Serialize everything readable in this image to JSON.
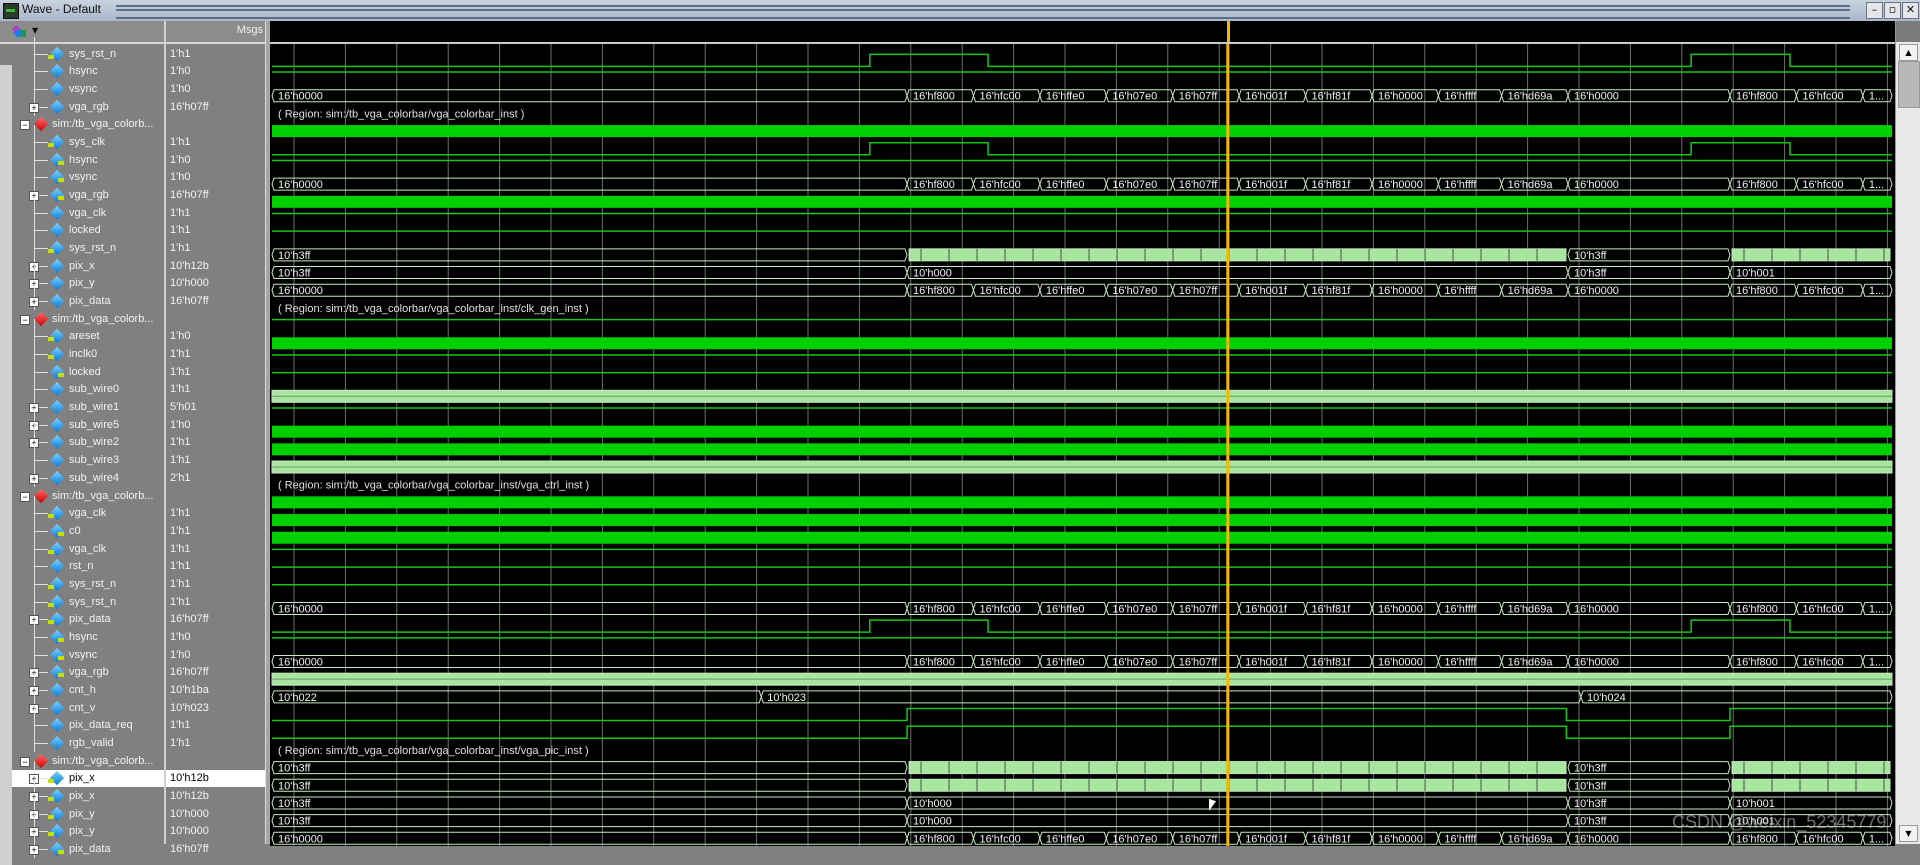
{
  "window": {
    "title": "Wave - Default",
    "buttons": [
      "minimize",
      "restore",
      "close"
    ]
  },
  "header": {
    "msgs_label": "Msgs",
    "toolbar_icon": "wave-format-icon"
  },
  "cursor": {
    "time_fraction": 0.59,
    "color": "#f5b800"
  },
  "colors": {
    "bus": "#c9e7c4",
    "scalar": "#14c814",
    "clockfill": "#00d000",
    "grid": "#8a8a8a",
    "busfill": "#a8e6a0",
    "region": "#e0e0e0"
  },
  "watermark": "CSDN @weixin_52345779",
  "rows": [
    {
      "type": "sig",
      "name": "sys_rst_n",
      "value": "1'h1",
      "indent": 1,
      "expand": false,
      "io": "in",
      "wave": {
        "kind": "scalar",
        "level": 1
      }
    },
    {
      "type": "sig",
      "name": "hsync",
      "value": "1'h0",
      "indent": 1,
      "expand": false,
      "io": "none",
      "wave": {
        "kind": "pulse",
        "pulses": [
          [
            0.369,
            0.442
          ],
          [
            0.876,
            0.937
          ]
        ]
      }
    },
    {
      "type": "sig",
      "name": "vsync",
      "value": "1'h0",
      "indent": 1,
      "expand": false,
      "io": "none",
      "wave": {
        "kind": "scalar",
        "level": 1
      }
    },
    {
      "type": "sig",
      "name": "vga_rgb",
      "value": "16'h07ff",
      "indent": 1,
      "expand": true,
      "io": "none",
      "wave": {
        "kind": "bus",
        "set": "rgb"
      }
    },
    {
      "type": "grp",
      "name": "sim:/tb_vga_colorb...",
      "region": "( Region: sim:/tb_vga_colorbar/vga_colorbar_inst )"
    },
    {
      "type": "sig",
      "name": "sys_clk",
      "value": "1'h1",
      "indent": 1,
      "expand": false,
      "io": "in",
      "wave": {
        "kind": "clock"
      }
    },
    {
      "type": "sig",
      "name": "hsync",
      "value": "1'h0",
      "indent": 1,
      "expand": false,
      "io": "out",
      "wave": {
        "kind": "pulse",
        "pulses": [
          [
            0.369,
            0.442
          ],
          [
            0.876,
            0.937
          ]
        ]
      }
    },
    {
      "type": "sig",
      "name": "vsync",
      "value": "1'h0",
      "indent": 1,
      "expand": false,
      "io": "out",
      "wave": {
        "kind": "scalar",
        "level": 1
      }
    },
    {
      "type": "sig",
      "name": "vga_rgb",
      "value": "16'h07ff",
      "indent": 1,
      "expand": true,
      "io": "out",
      "wave": {
        "kind": "bus",
        "set": "rgb"
      }
    },
    {
      "type": "sig",
      "name": "vga_clk",
      "value": "1'h1",
      "indent": 1,
      "expand": false,
      "io": "none",
      "wave": {
        "kind": "clock"
      }
    },
    {
      "type": "sig",
      "name": "locked",
      "value": "1'h1",
      "indent": 1,
      "expand": false,
      "io": "none",
      "wave": {
        "kind": "scalar",
        "level": 1
      }
    },
    {
      "type": "sig",
      "name": "sys_rst_n",
      "value": "1'h1",
      "indent": 1,
      "expand": false,
      "io": "in",
      "wave": {
        "kind": "scalar",
        "level": 1
      }
    },
    {
      "type": "sig",
      "name": "pix_x",
      "value": "10'h12b",
      "indent": 1,
      "expand": true,
      "io": "none",
      "wave": {
        "kind": "bus",
        "set": "pixx"
      }
    },
    {
      "type": "sig",
      "name": "pix_y",
      "value": "10'h000",
      "indent": 1,
      "expand": true,
      "io": "none",
      "wave": {
        "kind": "bus",
        "set": "pixy"
      }
    },
    {
      "type": "sig",
      "name": "pix_data",
      "value": "16'h07ff",
      "indent": 1,
      "expand": true,
      "io": "none",
      "wave": {
        "kind": "bus",
        "set": "rgb"
      }
    },
    {
      "type": "grp",
      "name": "sim:/tb_vga_colorb...",
      "region": "( Region: sim:/tb_vga_colorbar/vga_colorbar_inst/clk_gen_inst )"
    },
    {
      "type": "sig",
      "name": "areset",
      "value": "1'h0",
      "indent": 1,
      "expand": false,
      "io": "in",
      "wave": {
        "kind": "scalar",
        "level": 1
      }
    },
    {
      "type": "sig",
      "name": "inclk0",
      "value": "1'h1",
      "indent": 1,
      "expand": false,
      "io": "in",
      "wave": {
        "kind": "clock"
      }
    },
    {
      "type": "sig",
      "name": "locked",
      "value": "1'h1",
      "indent": 1,
      "expand": false,
      "io": "out",
      "wave": {
        "kind": "scalar",
        "level": 1
      }
    },
    {
      "type": "sig",
      "name": "sub_wire0",
      "value": "1'h1",
      "indent": 1,
      "expand": false,
      "io": "none",
      "wave": {
        "kind": "scalar",
        "level": 1
      }
    },
    {
      "type": "sig",
      "name": "sub_wire1",
      "value": "5'h01",
      "indent": 1,
      "expand": true,
      "io": "none",
      "wave": {
        "kind": "busfast"
      }
    },
    {
      "type": "sig",
      "name": "sub_wire5",
      "value": "1'h0",
      "indent": 1,
      "expand": true,
      "io": "none",
      "wave": {
        "kind": "scalar",
        "level": 1
      }
    },
    {
      "type": "sig",
      "name": "sub_wire2",
      "value": "1'h1",
      "indent": 1,
      "expand": true,
      "io": "none",
      "wave": {
        "kind": "clock"
      }
    },
    {
      "type": "sig",
      "name": "sub_wire3",
      "value": "1'h1",
      "indent": 1,
      "expand": false,
      "io": "none",
      "wave": {
        "kind": "clock"
      }
    },
    {
      "type": "sig",
      "name": "sub_wire4",
      "value": "2'h1",
      "indent": 1,
      "expand": true,
      "io": "none",
      "wave": {
        "kind": "busfast"
      }
    },
    {
      "type": "grp",
      "name": "sim:/tb_vga_colorb...",
      "region": "( Region: sim:/tb_vga_colorbar/vga_colorbar_inst/vga_ctrl_inst )"
    },
    {
      "type": "sig",
      "name": "vga_clk",
      "value": "1'h1",
      "indent": 1,
      "expand": false,
      "io": "in",
      "wave": {
        "kind": "clock"
      }
    },
    {
      "type": "sig",
      "name": "c0",
      "value": "1'h1",
      "indent": 1,
      "expand": false,
      "io": "out",
      "wave": {
        "kind": "clock"
      }
    },
    {
      "type": "sig",
      "name": "vga_clk",
      "value": "1'h1",
      "indent": 1,
      "expand": false,
      "io": "in",
      "wave": {
        "kind": "clock"
      }
    },
    {
      "type": "sig",
      "name": "rst_n",
      "value": "1'h1",
      "indent": 1,
      "expand": false,
      "io": "none",
      "wave": {
        "kind": "scalar",
        "level": 1
      }
    },
    {
      "type": "sig",
      "name": "sys_rst_n",
      "value": "1'h1",
      "indent": 1,
      "expand": false,
      "io": "in",
      "wave": {
        "kind": "scalar",
        "level": 1
      }
    },
    {
      "type": "sig",
      "name": "sys_rst_n",
      "value": "1'h1",
      "indent": 1,
      "expand": false,
      "io": "in",
      "wave": {
        "kind": "scalar",
        "level": 1
      }
    },
    {
      "type": "sig",
      "name": "pix_data",
      "value": "16'h07ff",
      "indent": 1,
      "expand": true,
      "io": "in",
      "wave": {
        "kind": "bus",
        "set": "rgb"
      }
    },
    {
      "type": "sig",
      "name": "hsync",
      "value": "1'h0",
      "indent": 1,
      "expand": false,
      "io": "out",
      "wave": {
        "kind": "pulse",
        "pulses": [
          [
            0.369,
            0.442
          ],
          [
            0.876,
            0.937
          ]
        ]
      }
    },
    {
      "type": "sig",
      "name": "vsync",
      "value": "1'h0",
      "indent": 1,
      "expand": false,
      "io": "out",
      "wave": {
        "kind": "scalar",
        "level": 1
      }
    },
    {
      "type": "sig",
      "name": "vga_rgb",
      "value": "16'h07ff",
      "indent": 1,
      "expand": true,
      "io": "out",
      "wave": {
        "kind": "bus",
        "set": "rgb"
      }
    },
    {
      "type": "sig",
      "name": "cnt_h",
      "value": "10'h1ba",
      "indent": 1,
      "expand": true,
      "io": "none",
      "wave": {
        "kind": "busfast"
      }
    },
    {
      "type": "sig",
      "name": "cnt_v",
      "value": "10'h023",
      "indent": 1,
      "expand": true,
      "io": "none",
      "wave": {
        "kind": "bus",
        "set": "cntv"
      }
    },
    {
      "type": "sig",
      "name": "pix_data_req",
      "value": "1'h1",
      "indent": 1,
      "expand": false,
      "io": "none",
      "wave": {
        "kind": "pulseinv",
        "lows": [
          [
            0,
            0.392
          ],
          [
            0.799,
            0.9
          ]
        ]
      }
    },
    {
      "type": "sig",
      "name": "rgb_valid",
      "value": "1'h1",
      "indent": 1,
      "expand": false,
      "io": "none",
      "wave": {
        "kind": "pulseinv",
        "lows": [
          [
            0,
            0.392
          ],
          [
            0.799,
            0.9
          ]
        ]
      }
    },
    {
      "type": "grp",
      "name": "sim:/tb_vga_colorb...",
      "region": "( Region: sim:/tb_vga_colorbar/vga_colorbar_inst/vga_pic_inst )"
    },
    {
      "type": "sig",
      "name": "pix_x",
      "value": "10'h12b",
      "indent": 1,
      "expand": true,
      "io": "in",
      "selected": true,
      "wave": {
        "kind": "bus",
        "set": "pixx"
      }
    },
    {
      "type": "sig",
      "name": "pix_x",
      "value": "10'h12b",
      "indent": 1,
      "expand": true,
      "io": "in",
      "wave": {
        "kind": "bus",
        "set": "pixx"
      }
    },
    {
      "type": "sig",
      "name": "pix_y",
      "value": "10'h000",
      "indent": 1,
      "expand": true,
      "io": "in",
      "wave": {
        "kind": "bus",
        "set": "pixy"
      }
    },
    {
      "type": "sig",
      "name": "pix_y",
      "value": "10'h000",
      "indent": 1,
      "expand": true,
      "io": "in",
      "wave": {
        "kind": "bus",
        "set": "pixy"
      }
    },
    {
      "type": "sig",
      "name": "pix_data",
      "value": "16'h07ff",
      "indent": 1,
      "expand": true,
      "io": "out",
      "wave": {
        "kind": "bus",
        "set": "rgb"
      }
    }
  ],
  "bus_sets": {
    "rgb": [
      {
        "t": 0,
        "label": "16'h0000"
      },
      {
        "t": 0.392,
        "label": "16'hf800"
      },
      {
        "t": 0.433,
        "label": "16'hfc00"
      },
      {
        "t": 0.474,
        "label": "16'hffe0"
      },
      {
        "t": 0.515,
        "label": "16'h07e0"
      },
      {
        "t": 0.556,
        "label": "16'h07ff"
      },
      {
        "t": 0.597,
        "label": "16'h001f"
      },
      {
        "t": 0.638,
        "label": "16'hf81f"
      },
      {
        "t": 0.679,
        "label": "16'h0000"
      },
      {
        "t": 0.72,
        "label": "16'hffff"
      },
      {
        "t": 0.759,
        "label": "16'hd69a"
      },
      {
        "t": 0.8,
        "label": "16'h0000"
      },
      {
        "t": 0.9,
        "label": "16'hf800"
      },
      {
        "t": 0.941,
        "label": "16'hfc00"
      },
      {
        "t": 0.982,
        "label": "1..."
      }
    ],
    "pixx": [
      {
        "t": 0,
        "label": "10'h3ff"
      },
      {
        "t": 0.392,
        "label": "",
        "fast": true
      },
      {
        "t": 0.8,
        "label": "10'h3ff"
      },
      {
        "t": 0.9,
        "label": "",
        "fast": true
      }
    ],
    "pixy": [
      {
        "t": 0,
        "label": "10'h3ff"
      },
      {
        "t": 0.392,
        "label": "10'h000"
      },
      {
        "t": 0.8,
        "label": "10'h3ff"
      },
      {
        "t": 0.9,
        "label": "10'h001"
      }
    ],
    "cntv": [
      {
        "t": 0,
        "label": "10'h022"
      },
      {
        "t": 0.302,
        "label": "10'h023"
      },
      {
        "t": 0.808,
        "label": "10'h024"
      }
    ]
  }
}
